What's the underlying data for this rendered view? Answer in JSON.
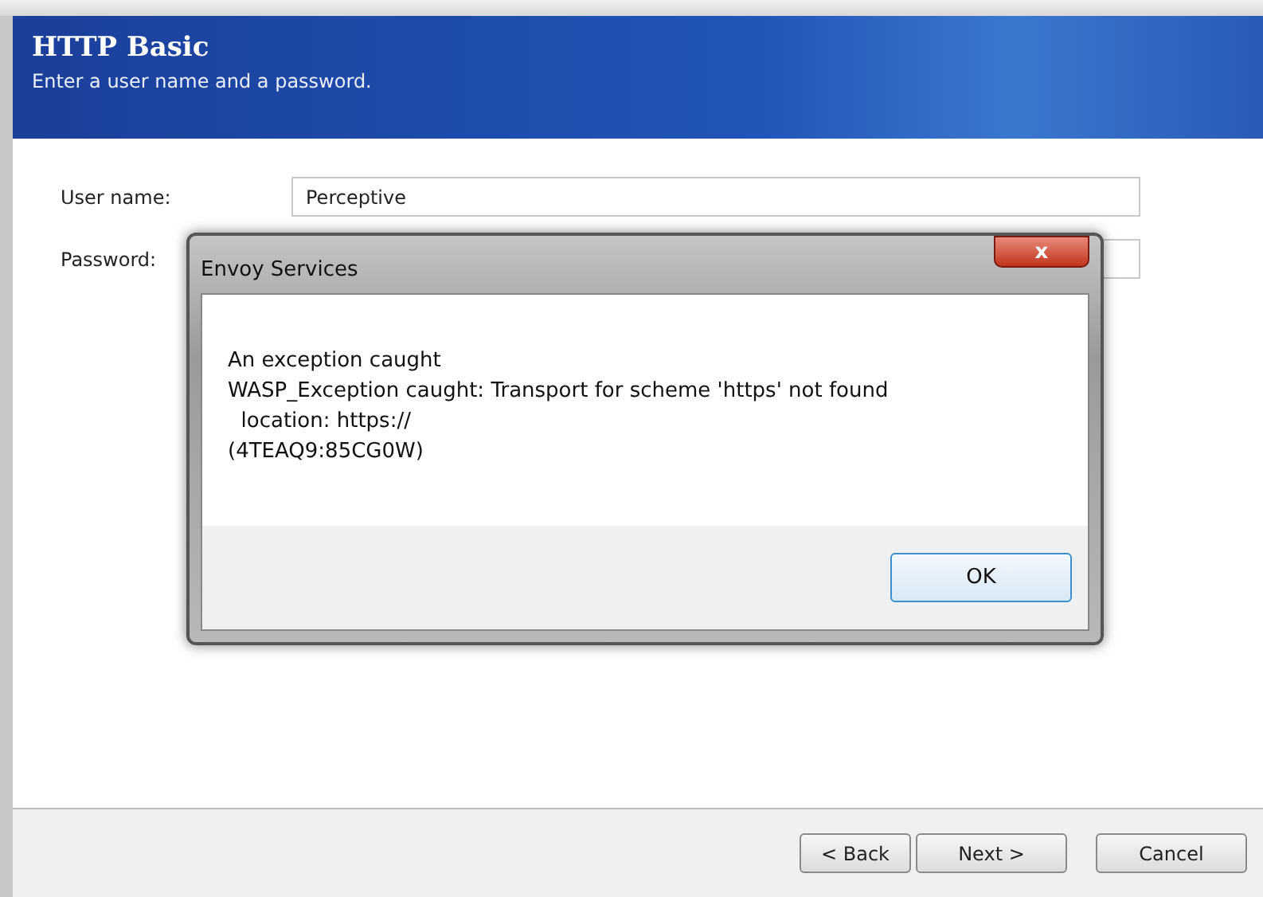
{
  "header": {
    "title": "HTTP Basic",
    "subtitle": "Enter a user name and a password."
  },
  "fields": [
    {
      "label": "User name:",
      "value": "Perceptive"
    },
    {
      "label": "Password:"
    }
  ],
  "dialog": {
    "title": "Envoy Services",
    "message_lines": [
      "An exception caught",
      "WASP_Exception caught: Transport for scheme 'https' not found",
      "  location: https://",
      "(4TEAQ9:85CG0W)"
    ],
    "close": "x",
    "ok": "OK"
  },
  "buttons": [
    "< Back",
    "Next >",
    "Cancel"
  ]
}
